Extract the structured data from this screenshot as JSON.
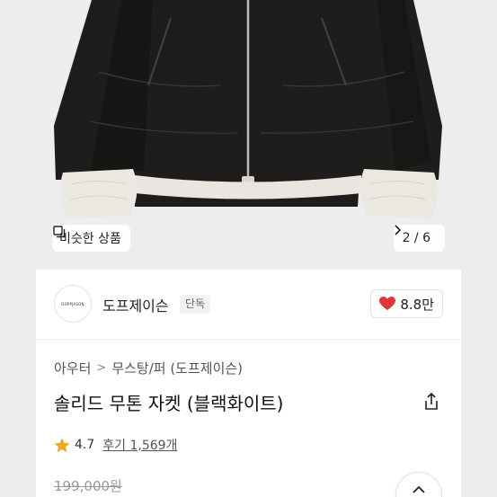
{
  "hero": {
    "similar_label": "비슷한 상품",
    "pager_text": "2 / 6",
    "image_name": "black-shearling-jacket"
  },
  "brand": {
    "logo_text": "DOPPJASON",
    "name": "도프제이슨",
    "tag": "단독",
    "like_count": "8.8만"
  },
  "product": {
    "breadcrumb": [
      "아우터",
      "무스탕/퍼 (도프제이슨)"
    ],
    "title": "솔리드 무톤 자켓 (블랙화이트)",
    "rating": "4.7",
    "reviews": "후기 1,569개",
    "original_price": "199,000원"
  },
  "colors": {
    "heart": "#e0343a",
    "star": "#f2a81d",
    "jacket": "#1f1d1b",
    "fur": "#e9e6df"
  }
}
